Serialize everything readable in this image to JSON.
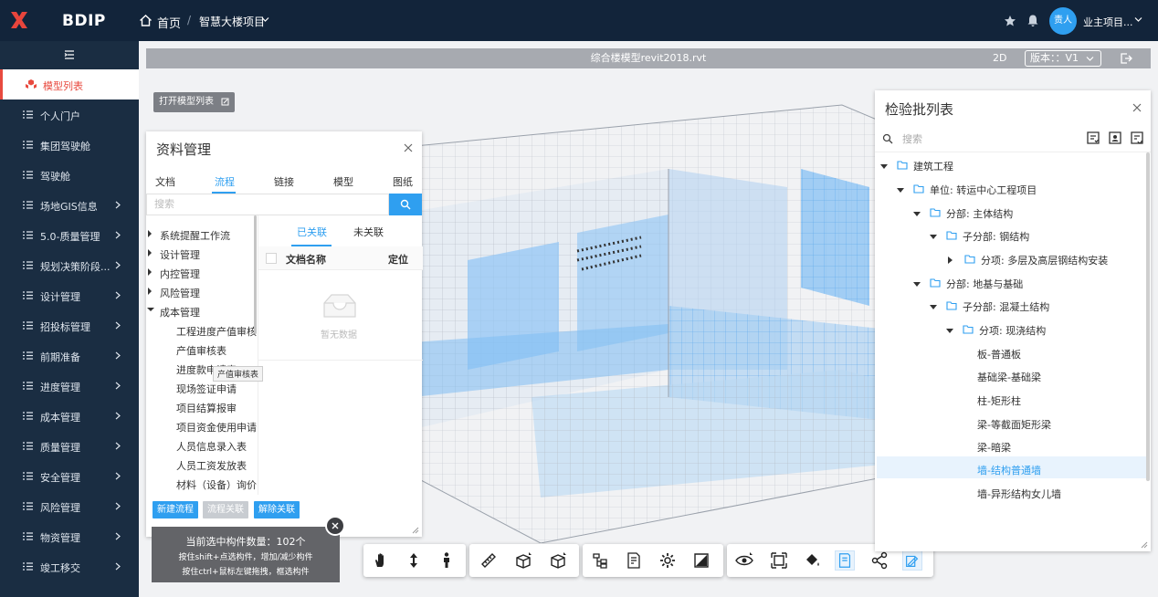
{
  "header": {
    "brand": "BDIP",
    "breadcrumb_home": "首页",
    "breadcrumb_sep": "/",
    "breadcrumb_project": "智慧大楼项目",
    "avatar_text": "责人",
    "user_name": "业主项目..."
  },
  "sidebar": {
    "items": [
      {
        "label": "模型列表"
      },
      {
        "label": "个人门户"
      },
      {
        "label": "集团驾驶舱"
      },
      {
        "label": "驾驶舱"
      },
      {
        "label": "场地GIS信息"
      },
      {
        "label": "5.0-质量管理"
      },
      {
        "label": "规划决策阶段..."
      },
      {
        "label": "设计管理"
      },
      {
        "label": "招投标管理"
      },
      {
        "label": "前期准备"
      },
      {
        "label": "进度管理"
      },
      {
        "label": "成本管理"
      },
      {
        "label": "质量管理"
      },
      {
        "label": "安全管理"
      },
      {
        "label": "风险管理"
      },
      {
        "label": "物资管理"
      },
      {
        "label": "竣工移交"
      }
    ]
  },
  "viewer": {
    "file_name": "综合楼模型revit2018.rvt",
    "mode_2d": "2D",
    "version_label": "版本：：V1",
    "open_model_list": "打开模型列表"
  },
  "docs_panel": {
    "title": "资料管理",
    "tabs": [
      "文档",
      "流程",
      "链接",
      "模型",
      "图纸"
    ],
    "search_placeholder": "搜索",
    "tree": [
      {
        "label": "系统提醒工作流"
      },
      {
        "label": "设计管理"
      },
      {
        "label": "内控管理"
      },
      {
        "label": "风险管理"
      },
      {
        "label": "成本管理"
      },
      {
        "label": "工程进度产值审核"
      },
      {
        "label": "产值审核表"
      },
      {
        "label": "进度款申请表"
      },
      {
        "label": "现场签证申请"
      },
      {
        "label": "项目结算报审"
      },
      {
        "label": "项目资金使用申请"
      },
      {
        "label": "人员信息录入表"
      },
      {
        "label": "人员工资发放表"
      },
      {
        "label": "材料（设备）询价"
      }
    ],
    "tooltip": "产值审核表",
    "rel_tab_on": "已关联",
    "rel_tab_off": "未关联",
    "col_name": "文档名称",
    "col_locate": "定位",
    "empty_text": "暂无数据",
    "btn_new": "新建流程",
    "btn_link": "流程关联",
    "btn_unlink": "解除关联"
  },
  "status": {
    "count_text": "当前选中构件数量：102个",
    "hint1": "按住shift+点选构件，增加/减少构件",
    "hint2": "按住ctrl+鼠标左键拖拽，框选构件"
  },
  "inspection_panel": {
    "title": "检验批列表",
    "search_placeholder": "搜索",
    "tree": [
      {
        "label": "建筑工程"
      },
      {
        "label": "单位: 转运中心工程项目"
      },
      {
        "label": "分部: 主体结构"
      },
      {
        "label": "子分部: 钢结构"
      },
      {
        "label": "分项: 多层及高层钢结构安装"
      },
      {
        "label": "分部: 地基与基础"
      },
      {
        "label": "子分部: 混凝土结构"
      },
      {
        "label": "分项: 现浇结构"
      },
      {
        "label": "板-普通板"
      },
      {
        "label": "基础梁-基础梁"
      },
      {
        "label": "柱-矩形柱"
      },
      {
        "label": "梁-等截面矩形梁"
      },
      {
        "label": "梁-暗梁"
      },
      {
        "label": "墙-结构普通墙"
      },
      {
        "label": "墙-异形结构女儿墙"
      }
    ]
  },
  "colors": {
    "accent": "#2f9ff0",
    "active_menu": "#e84a3f",
    "header_bg": "#12243a",
    "sidebar_bg": "#1a2d42"
  }
}
